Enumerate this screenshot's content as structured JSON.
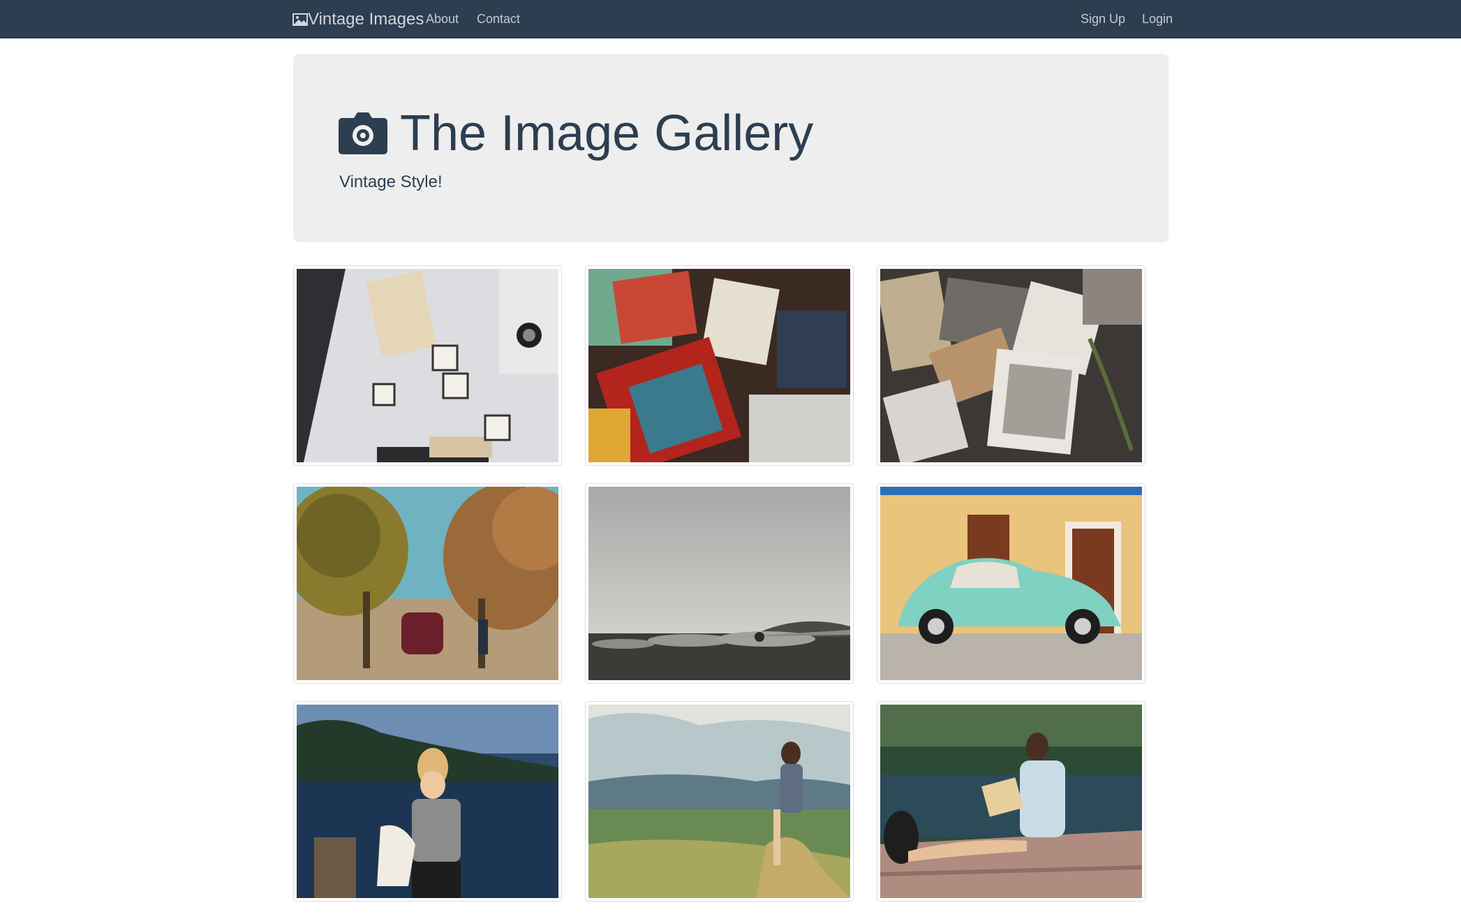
{
  "navbar": {
    "brand": "Vintage Images",
    "links": {
      "about": "About",
      "contact": "Contact",
      "signup": "Sign Up",
      "login": "Login"
    }
  },
  "jumbotron": {
    "title": "The Image Gallery",
    "subtitle": "Vintage Style!"
  },
  "colors": {
    "navbar_bg": "#2c3e50",
    "jumbotron_bg": "#eeeeee",
    "title_text": "#2c3e50"
  },
  "icons": {
    "brand": "picture-icon",
    "title": "camera-icon"
  }
}
